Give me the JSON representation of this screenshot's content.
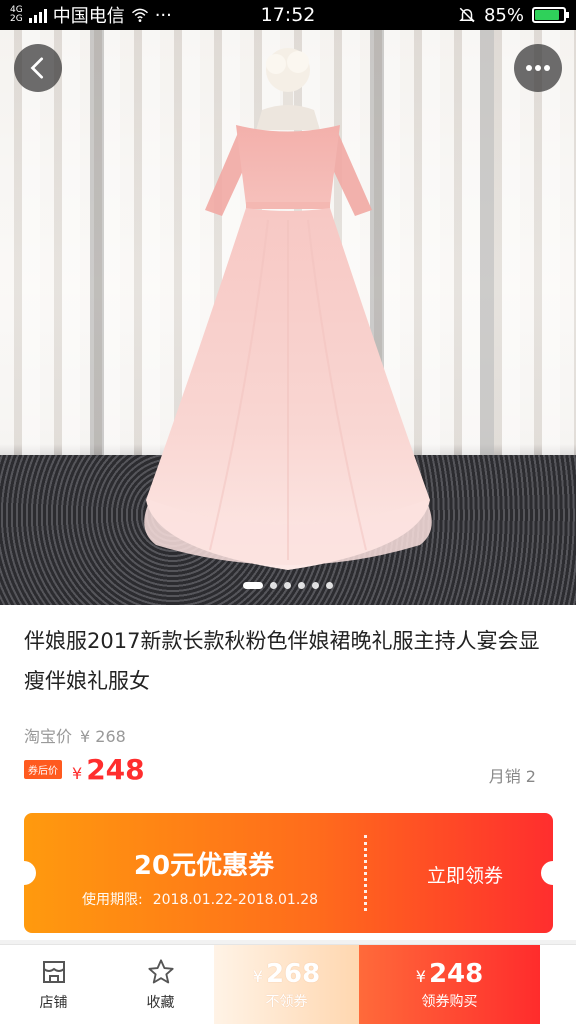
{
  "status_bar": {
    "network_type_top": "4G",
    "network_type_bottom": "2G",
    "carrier": "中国电信",
    "more": "···",
    "time": "17:52",
    "battery": "85%",
    "battery_level": 0.85,
    "battery_color": "#2fd15a"
  },
  "hero": {
    "carousel_count": 6,
    "carousel_active": 0,
    "back_icon": "chevron-left-icon",
    "more_icon": "ellipsis-icon"
  },
  "product": {
    "title": "伴娘服2017新款长款秋粉色伴娘裙晚礼服主持人宴会显瘦伴娘礼服女",
    "taobao_label": "淘宝价",
    "taobao_price": "¥ 268",
    "after_coupon_tag": "券后价",
    "currency": "¥",
    "after_coupon_price": "248",
    "monthly_sales": "月销 2"
  },
  "coupon": {
    "title": "20元优惠券",
    "validity_label": "使用期限:",
    "validity_range": "2018.01.22-2018.01.28",
    "claim_label": "立即领券"
  },
  "bottom_bar": {
    "shop_label": "店铺",
    "fav_label": "收藏",
    "no_coupon_currency": "¥",
    "no_coupon_price": "268",
    "no_coupon_label": "不领券",
    "with_coupon_currency": "¥",
    "with_coupon_price": "248",
    "with_coupon_label": "领券购买"
  },
  "colors": {
    "accent_red": "#ff2d2d",
    "coupon_start": "#ff9a0e",
    "coupon_end": "#ff2e2e"
  }
}
